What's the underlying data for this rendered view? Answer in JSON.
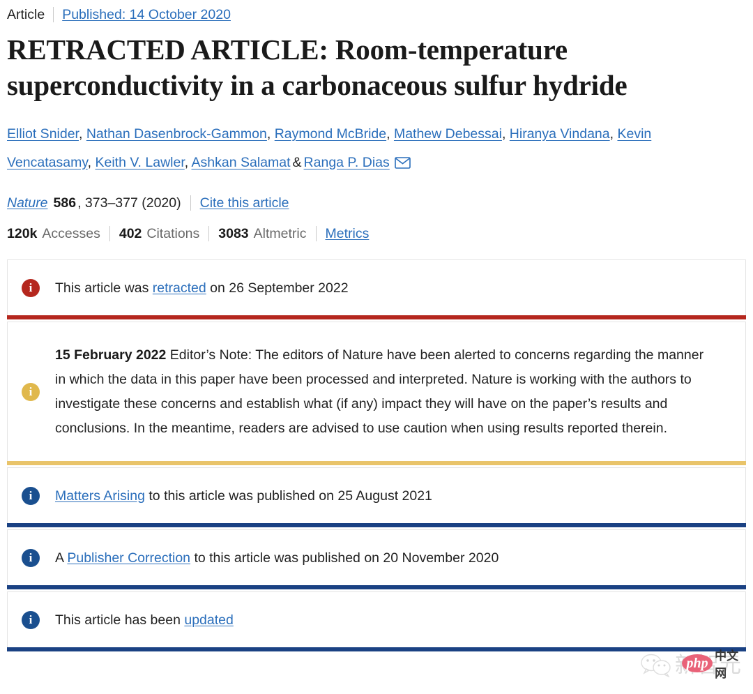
{
  "breadcrumb": {
    "type_label": "Article",
    "published_label": "Published: 14 October 2020"
  },
  "article": {
    "title": "RETRACTED ARTICLE: Room-temperature superconductivity in a carbonaceous sulfur hydride"
  },
  "authors": {
    "names": [
      "Elliot Snider",
      "Nathan Dasenbrock-Gammon",
      "Raymond McBride",
      "Mathew Debessai",
      "Hiranya Vindana",
      "Kevin Vencatasamy",
      "Keith V. Lawler",
      "Ashkan Salamat",
      "Ranga P. Dias"
    ],
    "separator": ",",
    "ampersand": "&",
    "corresponding_icon": "envelope-icon"
  },
  "citation": {
    "journal": "Nature",
    "volume": "586",
    "pages_year": ", 373–377 (2020)",
    "cite_link": "Cite this article"
  },
  "metrics": {
    "accesses_value": "120k",
    "accesses_label": "Accesses",
    "citations_value": "402",
    "citations_label": "Citations",
    "altmetric_value": "3083",
    "altmetric_label": "Altmetric",
    "metrics_link": "Metrics"
  },
  "notices": [
    {
      "id": "retraction",
      "icon": "info-icon",
      "icon_color": "#b5271e",
      "accent_color": "#b5271e",
      "text_before": "This article was ",
      "link": "retracted",
      "text_after": " on 26 September 2022"
    },
    {
      "id": "editors-note",
      "icon": "info-icon",
      "icon_color": "#e0b84c",
      "accent_color": "#e9c46a",
      "date": "15 February 2022",
      "body": " Editor’s Note: The editors of Nature have been alerted to concerns regarding the manner in which the data in this paper have been processed and interpreted. Nature is working with the authors to investigate these concerns and establish what (if any) impact they will have on the paper’s results and conclusions. In the meantime, readers are advised to use caution when using results reported therein."
    },
    {
      "id": "matters-arising",
      "icon": "info-icon",
      "icon_color": "#1a4f8f",
      "accent_color": "#1a4183",
      "text_before": "",
      "link": "Matters Arising",
      "text_after": " to this article was published on 25 August 2021"
    },
    {
      "id": "publisher-correction",
      "icon": "info-icon",
      "icon_color": "#1a4f8f",
      "accent_color": "#1a4183",
      "text_before": "A ",
      "link": "Publisher Correction",
      "text_after": " to this article was published on 20 November 2020"
    },
    {
      "id": "updated",
      "icon": "info-icon",
      "icon_color": "#1a4f8f",
      "accent_color": "#1a4183",
      "text_before": "This article has been ",
      "link": "updated",
      "text_after": ""
    }
  ],
  "watermark": {
    "wechat_icon": "wechat-icon",
    "brand_cn": "新智元",
    "badge_text": "php",
    "badge_suffix": "中文网"
  },
  "info_glyph": "i"
}
